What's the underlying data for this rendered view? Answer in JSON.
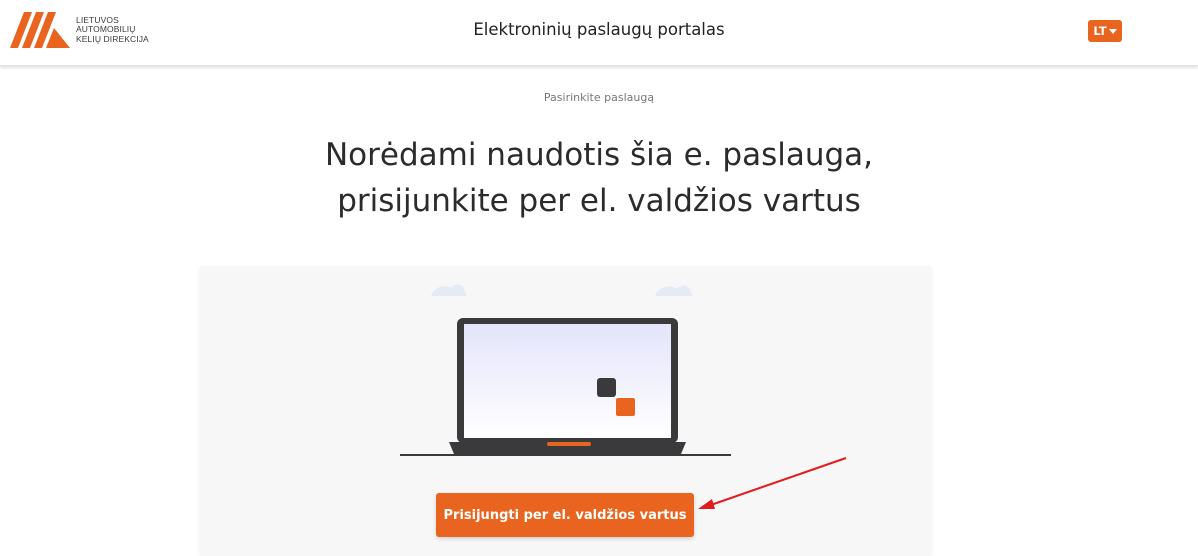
{
  "header": {
    "logo_lines": [
      "LIETUVOS",
      "AUTOMOBILIŲ",
      "KELIŲ DIREKCIJA"
    ],
    "title": "Elektroninių paslaugų portalas",
    "language": "LT"
  },
  "breadcrumb": "Pasirinkite paslaugą",
  "main": {
    "title_line1": "Norėdami naudotis šia e. paslauga,",
    "title_line2": "prisijunkite per el. valdžios vartus",
    "login_button": "Prisijungti per el. valdžios vartus"
  },
  "colors": {
    "accent": "#e8641f",
    "annotation_arrow": "#e21b1b",
    "laptop_dark": "#3a3a3c"
  },
  "icons": [
    "lakd-logo-icon",
    "caret-down-icon",
    "laptop-illustration",
    "cloud-icon",
    "annotation-arrow"
  ]
}
